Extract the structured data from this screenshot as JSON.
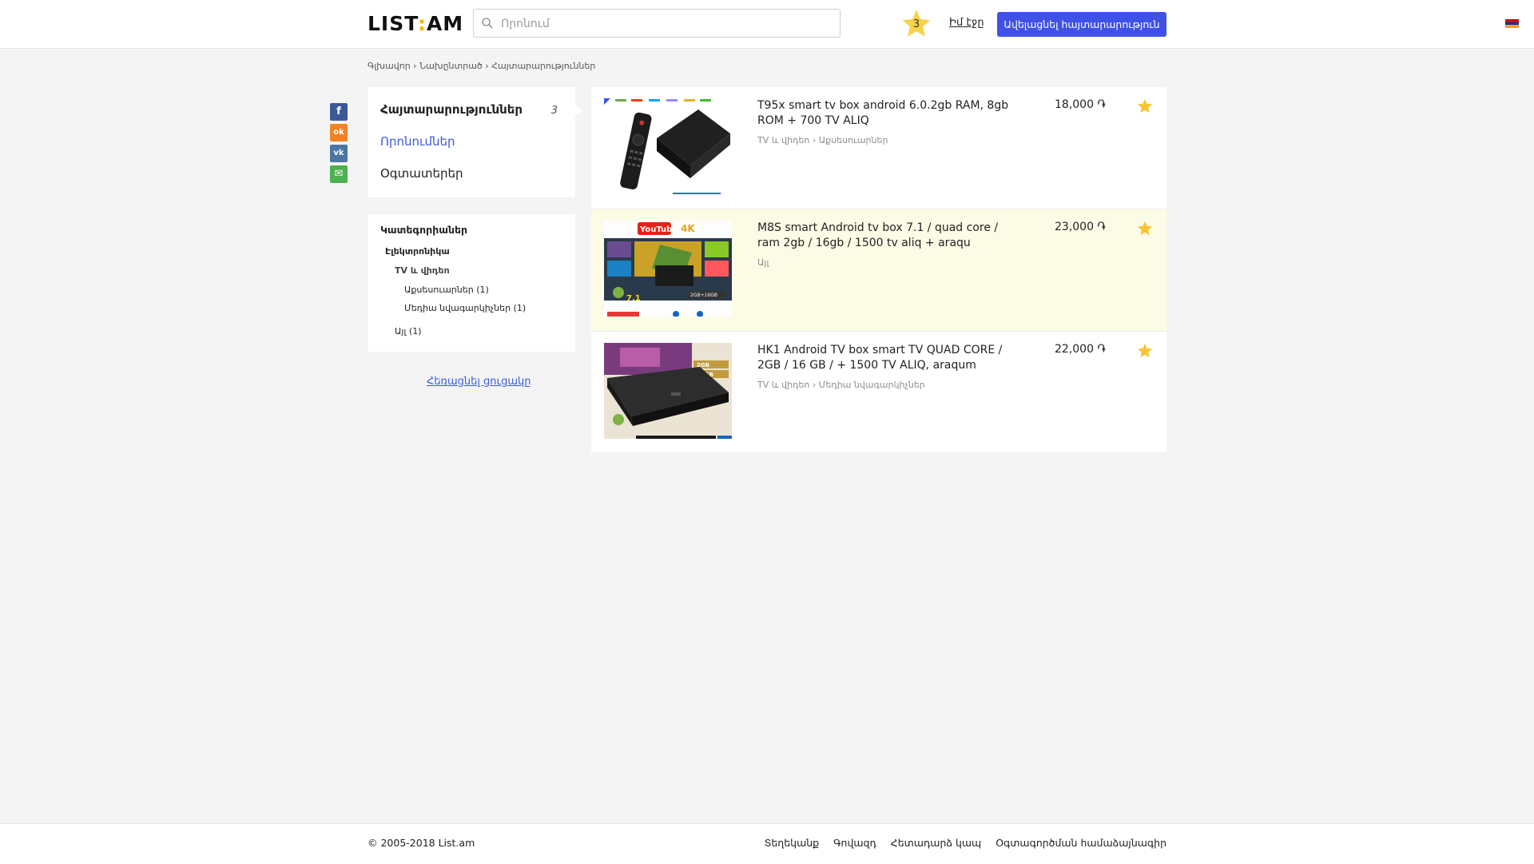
{
  "header": {
    "logo_text": "LIST",
    "logo_dot": ":",
    "logo_suffix": "AM",
    "search_placeholder": "Որոնում",
    "favorites_count": "3",
    "my_page": "Իմ էջը",
    "post_button": "Ավելացնել հայտարարություն",
    "flag_colors": [
      "#d90012",
      "#0033a0",
      "#f2a800"
    ]
  },
  "breadcrumb": "Գլխավոր › Նախընտրած › Հայտարարություններ",
  "social": [
    {
      "icon": "facebook-icon",
      "glyph": "f",
      "color": "#3b5998"
    },
    {
      "icon": "odnoklassniki-icon",
      "glyph": "ok",
      "color": "#f58220"
    },
    {
      "icon": "vk-icon",
      "glyph": "vk",
      "color": "#4c75a3"
    },
    {
      "icon": "email-icon",
      "glyph": "✉",
      "color": "#4caf50"
    }
  ],
  "menu": {
    "ads_label": "Հայտարարություններ",
    "ads_count": "3",
    "searches_label": "Որոնումներ",
    "users_label": "Օգտատերեր"
  },
  "categories": {
    "title": "Կատեգորիաներ",
    "level1": "Էլեկտրոնիկա",
    "level2": "TV և վիդեո",
    "level3a": "Աքսեսուարներ (1)",
    "level3b": "Մեդիա նվագարկիչներ (1)",
    "other": "Այլ (1)"
  },
  "back_link": "Հեռացնել ցուցակը",
  "listings": [
    {
      "title": "T95x smart tv box android 6.0.2gb RAM, 8gb ROM + 700 TV ALIQ",
      "category": "TV և վիդեո › Աքսեսուարներ",
      "price": "18,000 ֏",
      "highlight": false
    },
    {
      "title": "M8S smart Android tv box 7.1 / quad core / ram 2gb / 16gb / 1500 tv aliq + araqu",
      "category": "Այլ",
      "price": "23,000 ֏",
      "highlight": true
    },
    {
      "title": "HK1 Android TV box smart TV QUAD CORE / 2GB / 16 GB / + 1500 TV ALIQ, araqum",
      "category": "TV և վիդեո › Մեդիա նվագարկիչներ",
      "price": "22,000 ֏",
      "highlight": false
    }
  ],
  "thumb_labels": {
    "youtube": "YouTube",
    "k4": "4K",
    "android_version": "7.1",
    "ram_rom": "2GB+16GB",
    "hk1_2gb": "2GB",
    "hk1_16gb": "16GB"
  },
  "footer": {
    "copyright": "© 2005-2018 List.am",
    "links": [
      "Տեղեկանք",
      "Գովազդ",
      "Հետադարձ կապ",
      "Օգտագործման համաձայնագիր"
    ]
  },
  "colors": {
    "accent": "#3f51e6",
    "star": "#f7c531",
    "highlight_row": "#fcfbe6"
  }
}
